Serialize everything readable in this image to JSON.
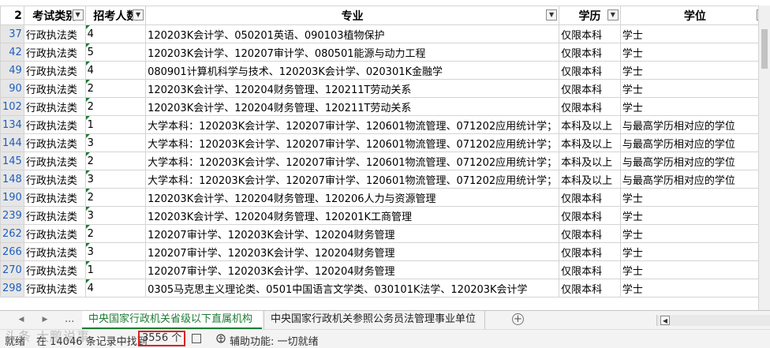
{
  "header": {
    "row_number": "2",
    "columns": [
      "考试类别",
      "招考人数",
      "专业",
      "学历",
      "学位"
    ]
  },
  "rows": [
    {
      "n": "37",
      "cat": "行政执法类",
      "num": "4",
      "major": "120203K会计学、050201英语、090103植物保护",
      "edu": "仅限本科",
      "deg": "学士"
    },
    {
      "n": "42",
      "cat": "行政执法类",
      "num": "5",
      "major": "120203K会计学、120207审计学、080501能源与动力工程",
      "edu": "仅限本科",
      "deg": "学士"
    },
    {
      "n": "49",
      "cat": "行政执法类",
      "num": "4",
      "major": "080901计算机科学与技术、120203K会计学、020301K金融学",
      "edu": "仅限本科",
      "deg": "学士"
    },
    {
      "n": "90",
      "cat": "行政执法类",
      "num": "2",
      "major": "120203K会计学、120204财务管理、120211T劳动关系",
      "edu": "仅限本科",
      "deg": "学士"
    },
    {
      "n": "102",
      "cat": "行政执法类",
      "num": "2",
      "major": "120203K会计学、120204财务管理、120211T劳动关系",
      "edu": "仅限本科",
      "deg": "学士"
    },
    {
      "n": "134",
      "cat": "行政执法类",
      "num": "1",
      "major": "大学本科：120203K会计学、120207审计学、120601物流管理、071202应用统计学；",
      "edu": "本科及以上",
      "deg": "与最高学历相对应的学位"
    },
    {
      "n": "144",
      "cat": "行政执法类",
      "num": "3",
      "major": "大学本科：120203K会计学、120207审计学、120601物流管理、071202应用统计学；",
      "edu": "本科及以上",
      "deg": "与最高学历相对应的学位"
    },
    {
      "n": "145",
      "cat": "行政执法类",
      "num": "2",
      "major": "大学本科：120203K会计学、120207审计学、120601物流管理、071202应用统计学；",
      "edu": "本科及以上",
      "deg": "与最高学历相对应的学位"
    },
    {
      "n": "148",
      "cat": "行政执法类",
      "num": "3",
      "major": "大学本科：120203K会计学、120207审计学、120601物流管理、071202应用统计学；",
      "edu": "本科及以上",
      "deg": "与最高学历相对应的学位"
    },
    {
      "n": "190",
      "cat": "行政执法类",
      "num": "2",
      "major": "120203K会计学、120204财务管理、120206人力与资源管理",
      "edu": "仅限本科",
      "deg": "学士"
    },
    {
      "n": "239",
      "cat": "行政执法类",
      "num": "3",
      "major": "120203K会计学、120204财务管理、120201K工商管理",
      "edu": "仅限本科",
      "deg": "学士"
    },
    {
      "n": "262",
      "cat": "行政执法类",
      "num": "2",
      "major": "120207审计学、120203K会计学、120204财务管理",
      "edu": "仅限本科",
      "deg": "学士"
    },
    {
      "n": "266",
      "cat": "行政执法类",
      "num": "3",
      "major": "120207审计学、120203K会计学、120204财务管理",
      "edu": "仅限本科",
      "deg": "学士"
    },
    {
      "n": "270",
      "cat": "行政执法类",
      "num": "1",
      "major": "120207审计学、120203K会计学、120204财务管理",
      "edu": "仅限本科",
      "deg": "学士"
    },
    {
      "n": "298",
      "cat": "行政执法类",
      "num": "4",
      "major": "0305马克思主义理论类、0501中国语言文学类、030101K法学、120203K会计学",
      "edu": "仅限本科",
      "deg": "学士"
    }
  ],
  "tabs": {
    "ellipsis": "...",
    "active": "中央国家行政机关省级以下直属机构",
    "inactive": "中央国家行政机关参照公务员法管理事业单位",
    "add": "+"
  },
  "status": {
    "ready": "就绪",
    "found_prefix": "在 14046 条记录中找到",
    "count": "3556 个",
    "accessibility": "辅助功能: 一切就绪"
  },
  "watermark": "头条 大鹏说事"
}
